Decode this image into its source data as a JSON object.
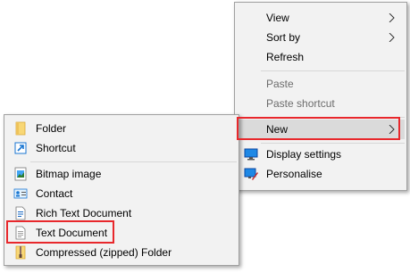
{
  "context_menu": {
    "items": [
      {
        "label": "View",
        "has_submenu": true,
        "enabled": true
      },
      {
        "label": "Sort by",
        "has_submenu": true,
        "enabled": true
      },
      {
        "label": "Refresh",
        "has_submenu": false,
        "enabled": true
      },
      {
        "label": "Paste",
        "has_submenu": false,
        "enabled": false
      },
      {
        "label": "Paste shortcut",
        "has_submenu": false,
        "enabled": false
      },
      {
        "label": "New",
        "has_submenu": true,
        "enabled": true,
        "highlighted": true
      },
      {
        "label": "Display settings",
        "icon": "display-icon",
        "enabled": true
      },
      {
        "label": "Personalise",
        "icon": "personalise-icon",
        "enabled": true
      }
    ]
  },
  "new_submenu": {
    "items": [
      {
        "label": "Folder",
        "icon": "folder-icon"
      },
      {
        "label": "Shortcut",
        "icon": "shortcut-icon"
      },
      {
        "label": "Bitmap image",
        "icon": "bitmap-icon"
      },
      {
        "label": "Contact",
        "icon": "contact-icon"
      },
      {
        "label": "Rich Text Document",
        "icon": "rtf-document-icon"
      },
      {
        "label": "Text Document",
        "icon": "text-document-icon",
        "highlighted": true
      },
      {
        "label": "Compressed (zipped) Folder",
        "icon": "zip-folder-icon"
      }
    ]
  },
  "colors": {
    "menu_background": "#f2f2f2",
    "highlight_background": "#dadada",
    "annotation_box": "#e8282c",
    "disabled_text": "#6d6d6d"
  }
}
